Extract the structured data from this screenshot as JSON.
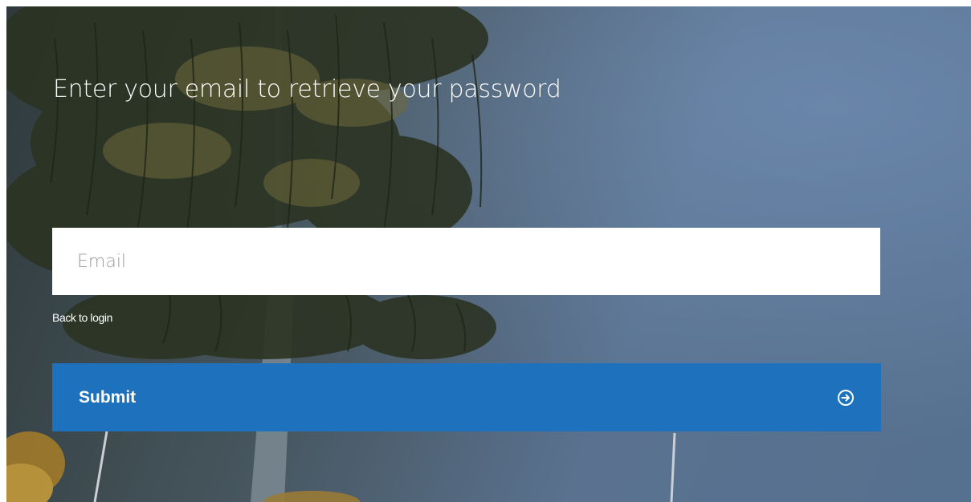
{
  "form": {
    "title": "Enter your email to retrieve your password",
    "email_placeholder": "Email",
    "back_link_label": "Back to login",
    "submit_label": "Submit",
    "submit_icon": "arrow-circle-right-icon"
  },
  "colors": {
    "submit_background": "#1e72bd",
    "text": "#ffffff",
    "field_background": "#ffffff"
  }
}
